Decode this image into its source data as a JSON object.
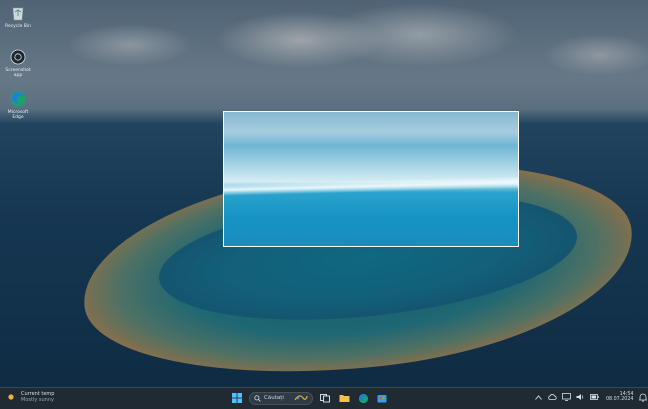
{
  "desktop": {
    "icons": [
      {
        "label": "Recycle Bin"
      },
      {
        "label": "Screenshot app"
      },
      {
        "label": "Microsoft Edge"
      }
    ]
  },
  "taskbar": {
    "weather": {
      "temperature": "Current temp",
      "condition": "Mostly sunny"
    },
    "search": {
      "placeholder": "Căutați"
    },
    "apps": [
      "start-icon",
      "search-icon",
      "copilot-icon",
      "task-view-icon",
      "file-explorer-icon",
      "edge-icon",
      "store-icon"
    ],
    "tray": {
      "time": "14:54",
      "date": "08.07.2024"
    }
  },
  "colors": {
    "taskbar_bg": "#202a33",
    "capture_border": "#ffffff",
    "accent": "#0a78d4"
  }
}
